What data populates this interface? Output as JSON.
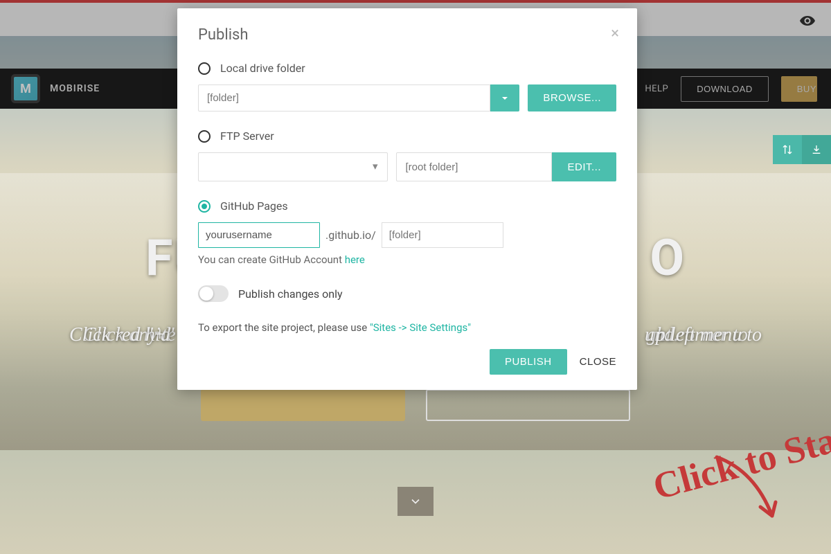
{
  "toolbar": {
    "eye_icon": "preview"
  },
  "nav": {
    "brand": "MOBIRISE",
    "help": "HELP",
    "download": "DOWNLOAD",
    "buy": "BUY"
  },
  "hero": {
    "title_left": "FU",
    "title_right": "O",
    "line1_left": "Click any te",
    "line1_right": "ght corner to",
    "line2_left": "hid",
    "line2_right": "und.",
    "line3_left": "Click red \"+\" i",
    "line3_right": "p left menu to"
  },
  "handwriting": "Click to Sta",
  "modal": {
    "title": "Publish",
    "options": {
      "local": {
        "label": "Local drive folder",
        "placeholder": "[folder]",
        "browse": "BROWSE..."
      },
      "ftp": {
        "label": "FTP Server",
        "root_placeholder": "[root folder]",
        "edit": "EDIT..."
      },
      "github": {
        "label": "GitHub Pages",
        "username": "yourusername",
        "suffix": ".github.io/",
        "folder_placeholder": "[folder]",
        "hint_pre": "You can create GitHub Account ",
        "hint_link": "here"
      }
    },
    "toggle_label": "Publish changes only",
    "export_pre": "To export the site project, please use ",
    "export_link": "\"Sites -> Site Settings\"",
    "publish_btn": "PUBLISH",
    "close_btn": "CLOSE"
  }
}
